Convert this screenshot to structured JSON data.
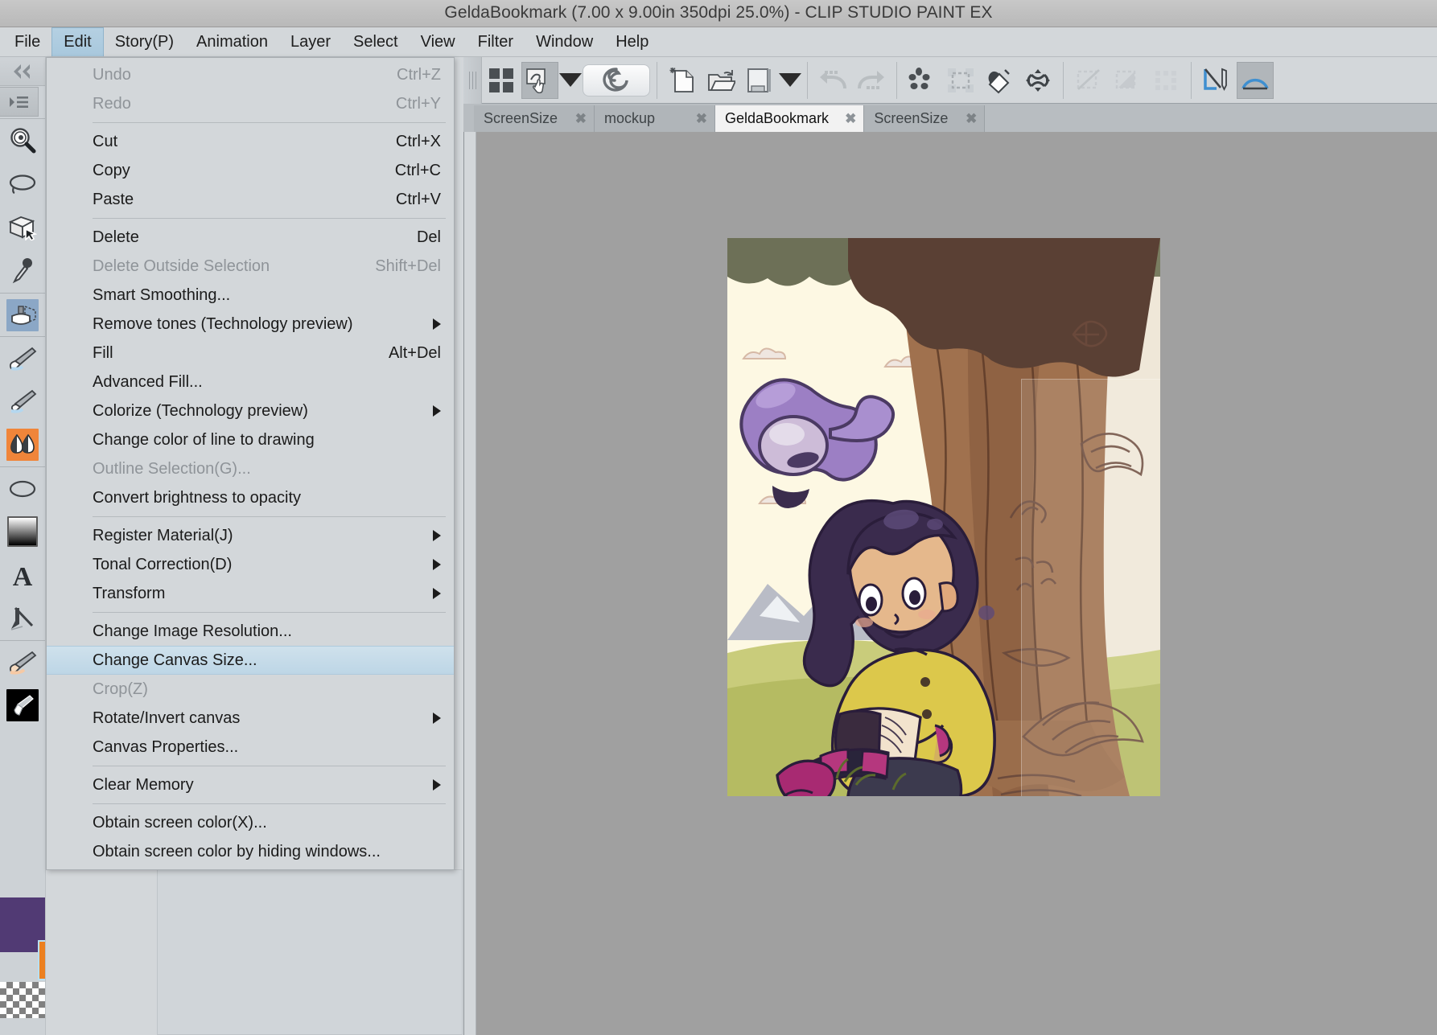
{
  "window": {
    "title": "GeldaBookmark (7.00 x 9.00in 350dpi 25.0%)  - CLIP STUDIO PAINT EX"
  },
  "menubar": {
    "items": [
      {
        "label": "File",
        "active": false
      },
      {
        "label": "Edit",
        "active": true
      },
      {
        "label": "Story(P)",
        "active": false
      },
      {
        "label": "Animation",
        "active": false
      },
      {
        "label": "Layer",
        "active": false
      },
      {
        "label": "Select",
        "active": false
      },
      {
        "label": "View",
        "active": false
      },
      {
        "label": "Filter",
        "active": false
      },
      {
        "label": "Window",
        "active": false
      },
      {
        "label": "Help",
        "active": false
      }
    ]
  },
  "edit_menu": {
    "items": [
      {
        "label": "Undo",
        "shortcut": "Ctrl+Z",
        "disabled": true,
        "submenu": false,
        "highlight": false
      },
      {
        "label": "Redo",
        "shortcut": "Ctrl+Y",
        "disabled": true,
        "submenu": false,
        "highlight": false
      },
      {
        "separator": true
      },
      {
        "label": "Cut",
        "shortcut": "Ctrl+X",
        "disabled": false,
        "submenu": false,
        "highlight": false
      },
      {
        "label": "Copy",
        "shortcut": "Ctrl+C",
        "disabled": false,
        "submenu": false,
        "highlight": false
      },
      {
        "label": "Paste",
        "shortcut": "Ctrl+V",
        "disabled": false,
        "submenu": false,
        "highlight": false
      },
      {
        "separator": true
      },
      {
        "label": "Delete",
        "shortcut": "Del",
        "disabled": false,
        "submenu": false,
        "highlight": false
      },
      {
        "label": "Delete Outside Selection",
        "shortcut": "Shift+Del",
        "disabled": true,
        "submenu": false,
        "highlight": false
      },
      {
        "label": "Smart Smoothing...",
        "shortcut": "",
        "disabled": false,
        "submenu": false,
        "highlight": false
      },
      {
        "label": "Remove tones (Technology preview)",
        "shortcut": "",
        "disabled": false,
        "submenu": true,
        "highlight": false
      },
      {
        "label": "Fill",
        "shortcut": "Alt+Del",
        "disabled": false,
        "submenu": false,
        "highlight": false
      },
      {
        "label": "Advanced Fill...",
        "shortcut": "",
        "disabled": false,
        "submenu": false,
        "highlight": false
      },
      {
        "label": "Colorize (Technology preview)",
        "shortcut": "",
        "disabled": false,
        "submenu": true,
        "highlight": false
      },
      {
        "label": "Change color of line to drawing",
        "shortcut": "",
        "disabled": false,
        "submenu": false,
        "highlight": false
      },
      {
        "label": "Outline Selection(G)...",
        "shortcut": "",
        "disabled": true,
        "submenu": false,
        "highlight": false
      },
      {
        "label": "Convert brightness to opacity",
        "shortcut": "",
        "disabled": false,
        "submenu": false,
        "highlight": false
      },
      {
        "separator": true
      },
      {
        "label": "Register Material(J)",
        "shortcut": "",
        "disabled": false,
        "submenu": true,
        "highlight": false
      },
      {
        "label": "Tonal Correction(D)",
        "shortcut": "",
        "disabled": false,
        "submenu": true,
        "highlight": false
      },
      {
        "label": "Transform",
        "shortcut": "",
        "disabled": false,
        "submenu": true,
        "highlight": false
      },
      {
        "separator": true
      },
      {
        "label": "Change Image Resolution...",
        "shortcut": "",
        "disabled": false,
        "submenu": false,
        "highlight": false
      },
      {
        "label": "Change Canvas Size...",
        "shortcut": "",
        "disabled": false,
        "submenu": false,
        "highlight": true
      },
      {
        "label": "Crop(Z)",
        "shortcut": "",
        "disabled": true,
        "submenu": false,
        "highlight": false
      },
      {
        "label": "Rotate/Invert canvas",
        "shortcut": "",
        "disabled": false,
        "submenu": true,
        "highlight": false
      },
      {
        "label": "Canvas Properties...",
        "shortcut": "",
        "disabled": false,
        "submenu": false,
        "highlight": false
      },
      {
        "separator": true
      },
      {
        "label": "Clear Memory",
        "shortcut": "",
        "disabled": false,
        "submenu": true,
        "highlight": false
      },
      {
        "separator": true
      },
      {
        "label": "Obtain screen color(X)...",
        "shortcut": "",
        "disabled": false,
        "submenu": false,
        "highlight": false
      },
      {
        "label": "Obtain screen color by hiding windows...",
        "shortcut": "",
        "disabled": false,
        "submenu": false,
        "highlight": false
      }
    ]
  },
  "command_bar": {
    "buttons": [
      {
        "icon": "grid-four-squares-icon",
        "pressed": false,
        "disabled": false
      },
      {
        "icon": "quick-access-hand-icon",
        "pressed": true,
        "disabled": false
      },
      {
        "icon": "chevron-down-icon",
        "pressed": false,
        "disabled": false
      },
      {
        "icon": "clip-studio-swirl-icon",
        "pressed": false,
        "disabled": false
      },
      {
        "icon": "new-document-icon",
        "pressed": false,
        "disabled": false
      },
      {
        "icon": "open-folder-icon",
        "pressed": false,
        "disabled": false
      },
      {
        "icon": "save-icon",
        "pressed": false,
        "disabled": false
      },
      {
        "icon": "chevron-down-icon",
        "pressed": false,
        "disabled": false
      },
      {
        "icon": "undo-arrow-icon",
        "pressed": false,
        "disabled": true
      },
      {
        "icon": "redo-arrow-icon",
        "pressed": false,
        "disabled": true
      },
      {
        "icon": "select-dots-icon",
        "pressed": false,
        "disabled": false
      },
      {
        "icon": "deselect-icon",
        "pressed": false,
        "disabled": false
      },
      {
        "icon": "fill-bucket-icon",
        "pressed": false,
        "disabled": false
      },
      {
        "icon": "transform-icon",
        "pressed": false,
        "disabled": false
      },
      {
        "icon": "clear-selection-icon",
        "pressed": false,
        "disabled": true
      },
      {
        "icon": "fill-selection-icon",
        "pressed": false,
        "disabled": true
      },
      {
        "icon": "expand-selection-icon",
        "pressed": false,
        "disabled": true
      },
      {
        "icon": "ruler-pen-icon",
        "pressed": false,
        "disabled": false
      },
      {
        "icon": "curve-ruler-icon",
        "pressed": true,
        "disabled": false
      }
    ]
  },
  "doc_tabs": [
    {
      "label": "ScreenSize",
      "active": false,
      "close": "✖"
    },
    {
      "label": "mockup",
      "active": false,
      "close": "✖"
    },
    {
      "label": "GeldaBookmark",
      "active": true,
      "close": "✖"
    },
    {
      "label": "ScreenSize",
      "active": false,
      "close": "✖"
    }
  ],
  "tools": [
    {
      "icon": "zoom-magnifier-icon",
      "selected": false,
      "group_start": true
    },
    {
      "icon": "lasso-ellipse-icon",
      "selected": false,
      "group_start": false
    },
    {
      "icon": "object-cube-icon",
      "selected": false,
      "group_start": false
    },
    {
      "icon": "eyedropper-icon",
      "selected": false,
      "group_start": false
    },
    {
      "icon": "airbrush-icon",
      "selected": true,
      "group_start": true
    },
    {
      "icon": "pen-brush-icon",
      "selected": false,
      "group_start": true
    },
    {
      "icon": "pencil-brush-icon",
      "selected": false,
      "group_start": false
    },
    {
      "icon": "blend-water-icon",
      "selected": false,
      "group_start": false
    },
    {
      "icon": "ellipse-shape-icon",
      "selected": false,
      "group_start": true
    },
    {
      "icon": "gradient-icon",
      "selected": false,
      "group_start": false
    },
    {
      "icon": "text-tool-icon",
      "selected": false,
      "group_start": false
    },
    {
      "icon": "ruler-tool-icon",
      "selected": false,
      "group_start": false
    },
    {
      "icon": "eraser-icon",
      "selected": false,
      "group_start": true
    },
    {
      "icon": "correct-line-icon",
      "selected": false,
      "group_start": false
    }
  ],
  "left_dock": {
    "collapse_icon": "double-chevron-left-icon",
    "palette_icon": "palette-list-icon"
  },
  "colors": {
    "main_color": "#513a74",
    "sub_color": "#ec8020",
    "transparent_label": "transparent-checker",
    "canvas_bg": "#a0a0a0",
    "panel_bg": "#d3d7da",
    "highlight_blue": "#bdd6e6",
    "titlebar_bg": "#c0c0c0"
  },
  "artwork": {
    "description": "girl-reading-under-tree-illustration",
    "paper_bg": "#fdf8e3"
  }
}
